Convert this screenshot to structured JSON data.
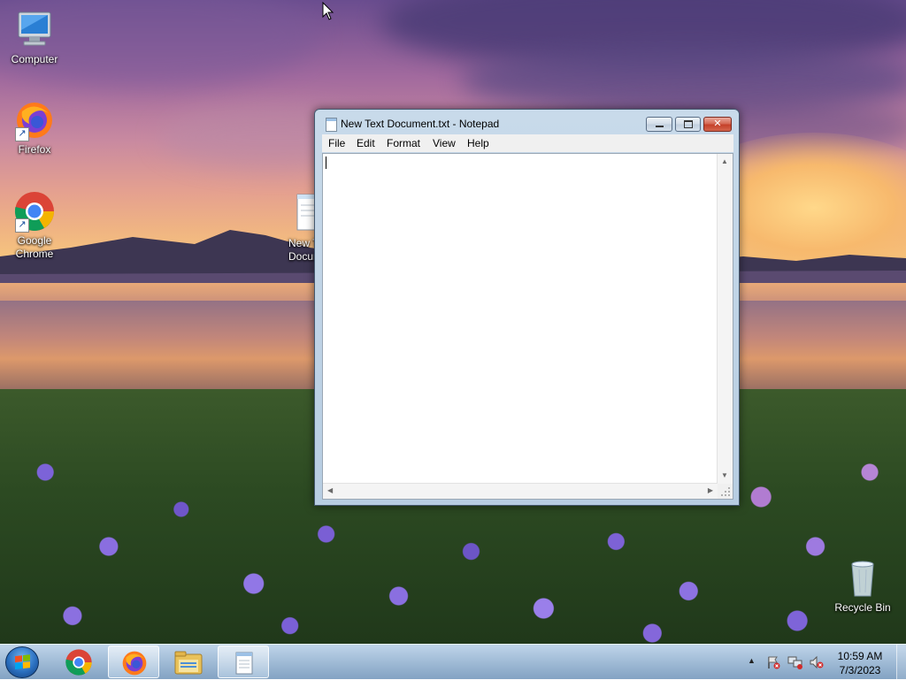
{
  "desktop": {
    "icons": [
      {
        "label": "Computer"
      },
      {
        "label": "Firefox"
      },
      {
        "label": "Google Chrome"
      },
      {
        "label": "New T\nDocum"
      },
      {
        "label": "Recycle Bin"
      }
    ]
  },
  "notepad": {
    "title": "New Text Document.txt - Notepad",
    "menu": [
      "File",
      "Edit",
      "Format",
      "View",
      "Help"
    ],
    "content": "",
    "buttons": {
      "minimize": "minimize-icon",
      "maximize": "maximize-icon",
      "close": "close-icon"
    }
  },
  "taskbar": {
    "pinned": [
      "chrome",
      "firefox",
      "file-explorer",
      "notepad"
    ],
    "active": "notepad"
  },
  "tray": {
    "time": "10:59 AM",
    "date": "7/3/2023"
  }
}
